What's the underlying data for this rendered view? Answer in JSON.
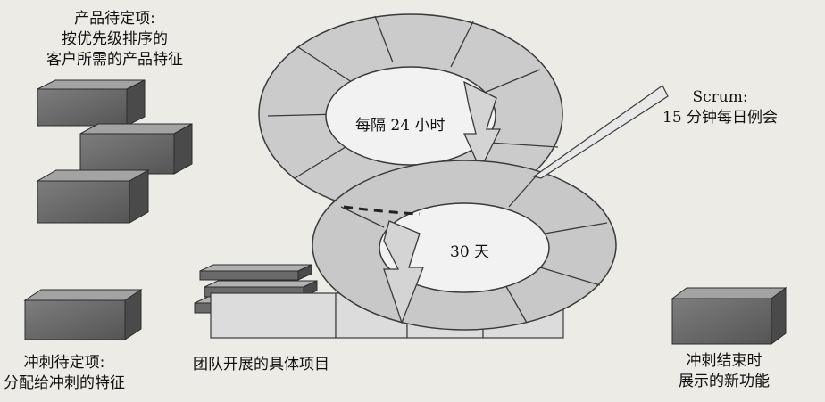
{
  "labels": {
    "product_backlog": [
      "产品待定项:",
      "按优先级排序的",
      "客户所需的产品特征"
    ],
    "sprint_backlog": [
      "冲刺待定项:",
      "分配给冲刺的特征"
    ],
    "team_tasks": "团队开展的具体项目",
    "increment": [
      "冲刺结束时",
      "展示的新功能"
    ],
    "daily_cycle": "每隔 24 小时",
    "sprint_cycle": "30 天",
    "scrum_meeting": [
      "Scrum:",
      "15 分钟每日例会"
    ]
  },
  "colors": {
    "background": "#ecebe6",
    "box_front": "#6f6f6f",
    "box_top": "#9a9a9a",
    "box_side": "#4d4d4d",
    "ring_fill": "#c9c9c9",
    "ring_stroke": "#3a3a3a",
    "inner_fill": "#f2f2f2"
  }
}
